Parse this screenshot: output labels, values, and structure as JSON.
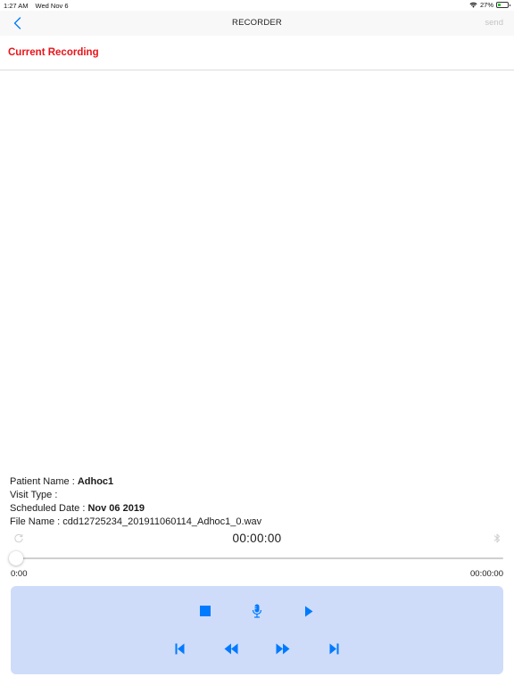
{
  "status_bar": {
    "time": "1:27 AM",
    "date": "Wed Nov 6",
    "battery": "27%",
    "battery_level": 0.27
  },
  "nav": {
    "title": "RECORDER",
    "send_label": "send",
    "back_icon": "chevron-left-icon"
  },
  "section": {
    "title": "Current Recording"
  },
  "info": {
    "patient_label": "Patient Name : ",
    "patient_value": "Adhoc1",
    "visit_label": "Visit Type : ",
    "visit_value": "",
    "date_label": "Scheduled Date : ",
    "date_value": "Nov 06 2019",
    "file_label": "File Name : ",
    "file_value": "cdd12725234_201911060114_Adhoc1_0.wav"
  },
  "player": {
    "timer": "00:00:00",
    "start_time": "0:00",
    "end_time": "00:00:00",
    "progress": 0
  },
  "controls": {
    "row1": [
      "stop-icon",
      "microphone-icon",
      "play-icon"
    ],
    "row2": [
      "skip-back-icon",
      "rewind-icon",
      "fast-forward-icon",
      "skip-forward-icon"
    ]
  },
  "colors": {
    "accent": "#007aff",
    "header_red": "#e8141a",
    "controls_bg": "#cedcfa",
    "send_disabled": "#c4c4c4"
  }
}
